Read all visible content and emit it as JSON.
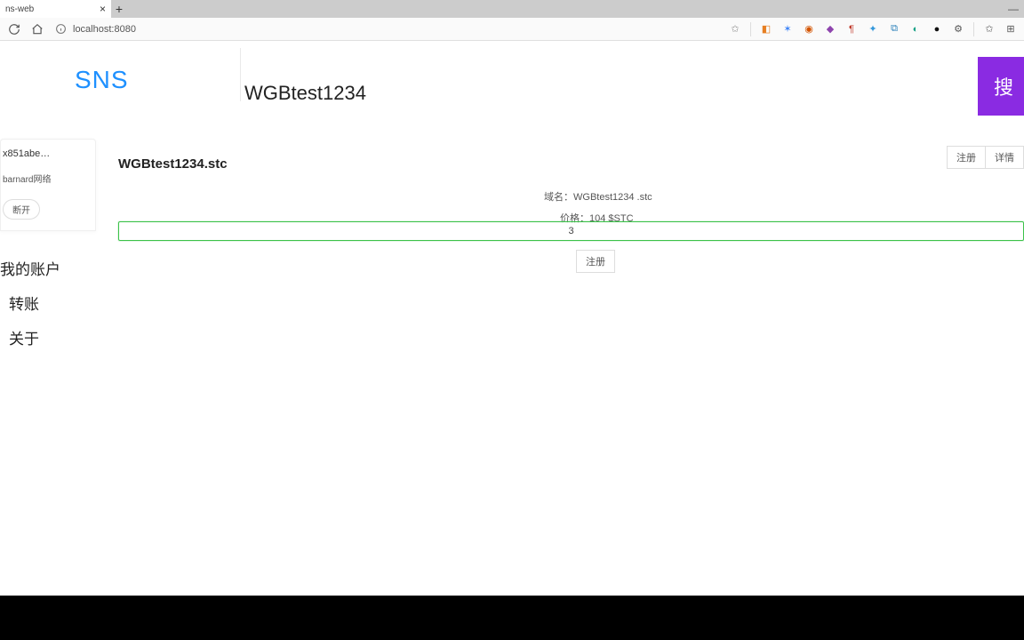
{
  "browser": {
    "tab_title": "ns-web",
    "url": "localhost:8080"
  },
  "logo_text": "SNS",
  "sidebar": {
    "address": "x851abe…",
    "network": "barnard网络",
    "disconnect": "断开",
    "nav": [
      "我的账户",
      "转账",
      "关于"
    ]
  },
  "search": {
    "value": "WGBtest1234",
    "button": "搜"
  },
  "card_buttons": {
    "register": "注册",
    "detail": "详情"
  },
  "domain_full": "WGBtest1234.stc",
  "info": {
    "domain_label": "域名：",
    "domain_value": "WGBtest1234 .stc",
    "price_label": "价格：",
    "price_value": "104 $STC"
  },
  "years_value": "3",
  "register_small": "注册"
}
